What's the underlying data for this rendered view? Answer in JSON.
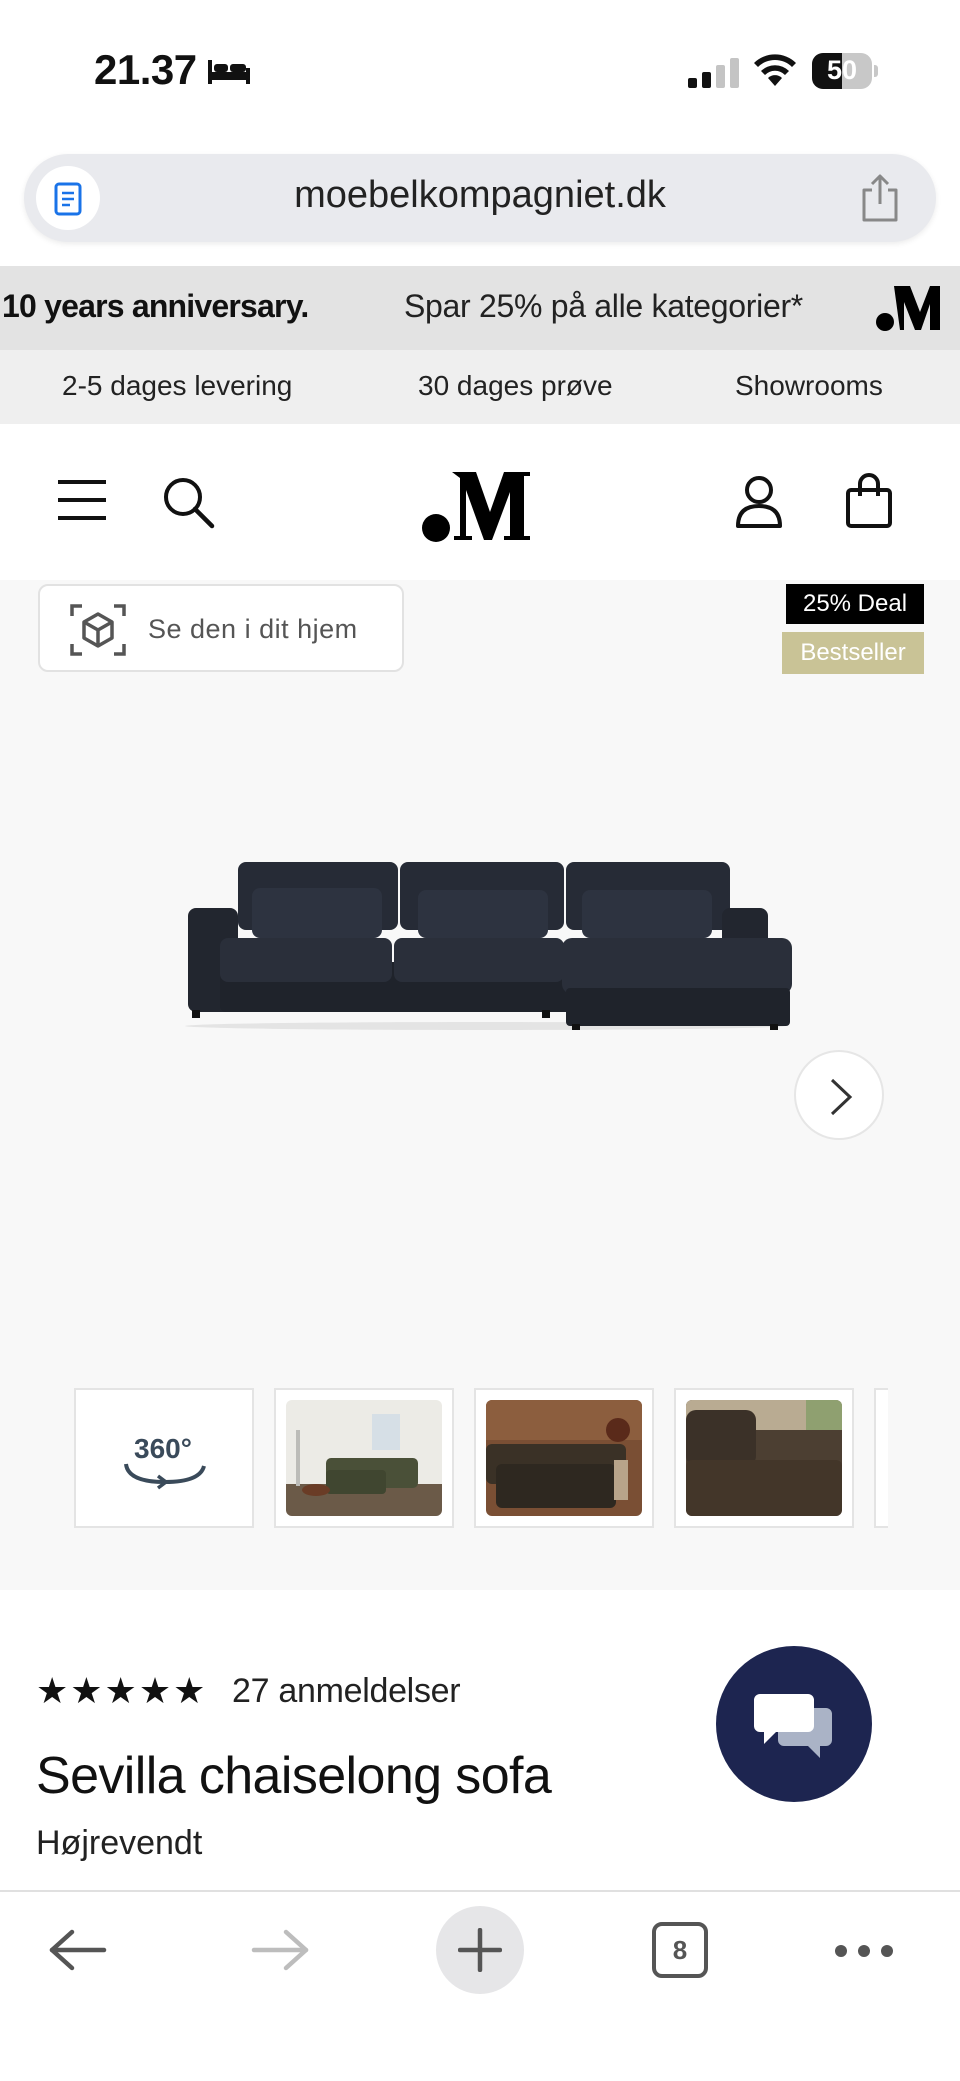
{
  "status_bar": {
    "time": "21.37",
    "battery": "50",
    "battery_level": 0.5
  },
  "browser": {
    "url": "moebelkompagniet.dk"
  },
  "banner": {
    "left": "10 years anniversary.",
    "offer": "Spar 25% på alle kategorier*"
  },
  "usp": [
    "2-5 dages levering",
    "30 dages prøve",
    "Showrooms"
  ],
  "product": {
    "ar_label": "Se den i dit hjem",
    "badges": [
      "25% Deal",
      "Bestseller"
    ],
    "thumb_360": "360°",
    "stars": "★★★★★",
    "rating": 5,
    "reviews": "27 anmeldelser",
    "title": "Sevilla chaiselong sofa",
    "variant": "Højrevendt"
  },
  "toolbar": {
    "tab_count": "8"
  },
  "colors": {
    "badge_black": "#000000",
    "badge_gold": "#c9c396",
    "chat": "#1d2550",
    "sofa": "#262b36"
  }
}
